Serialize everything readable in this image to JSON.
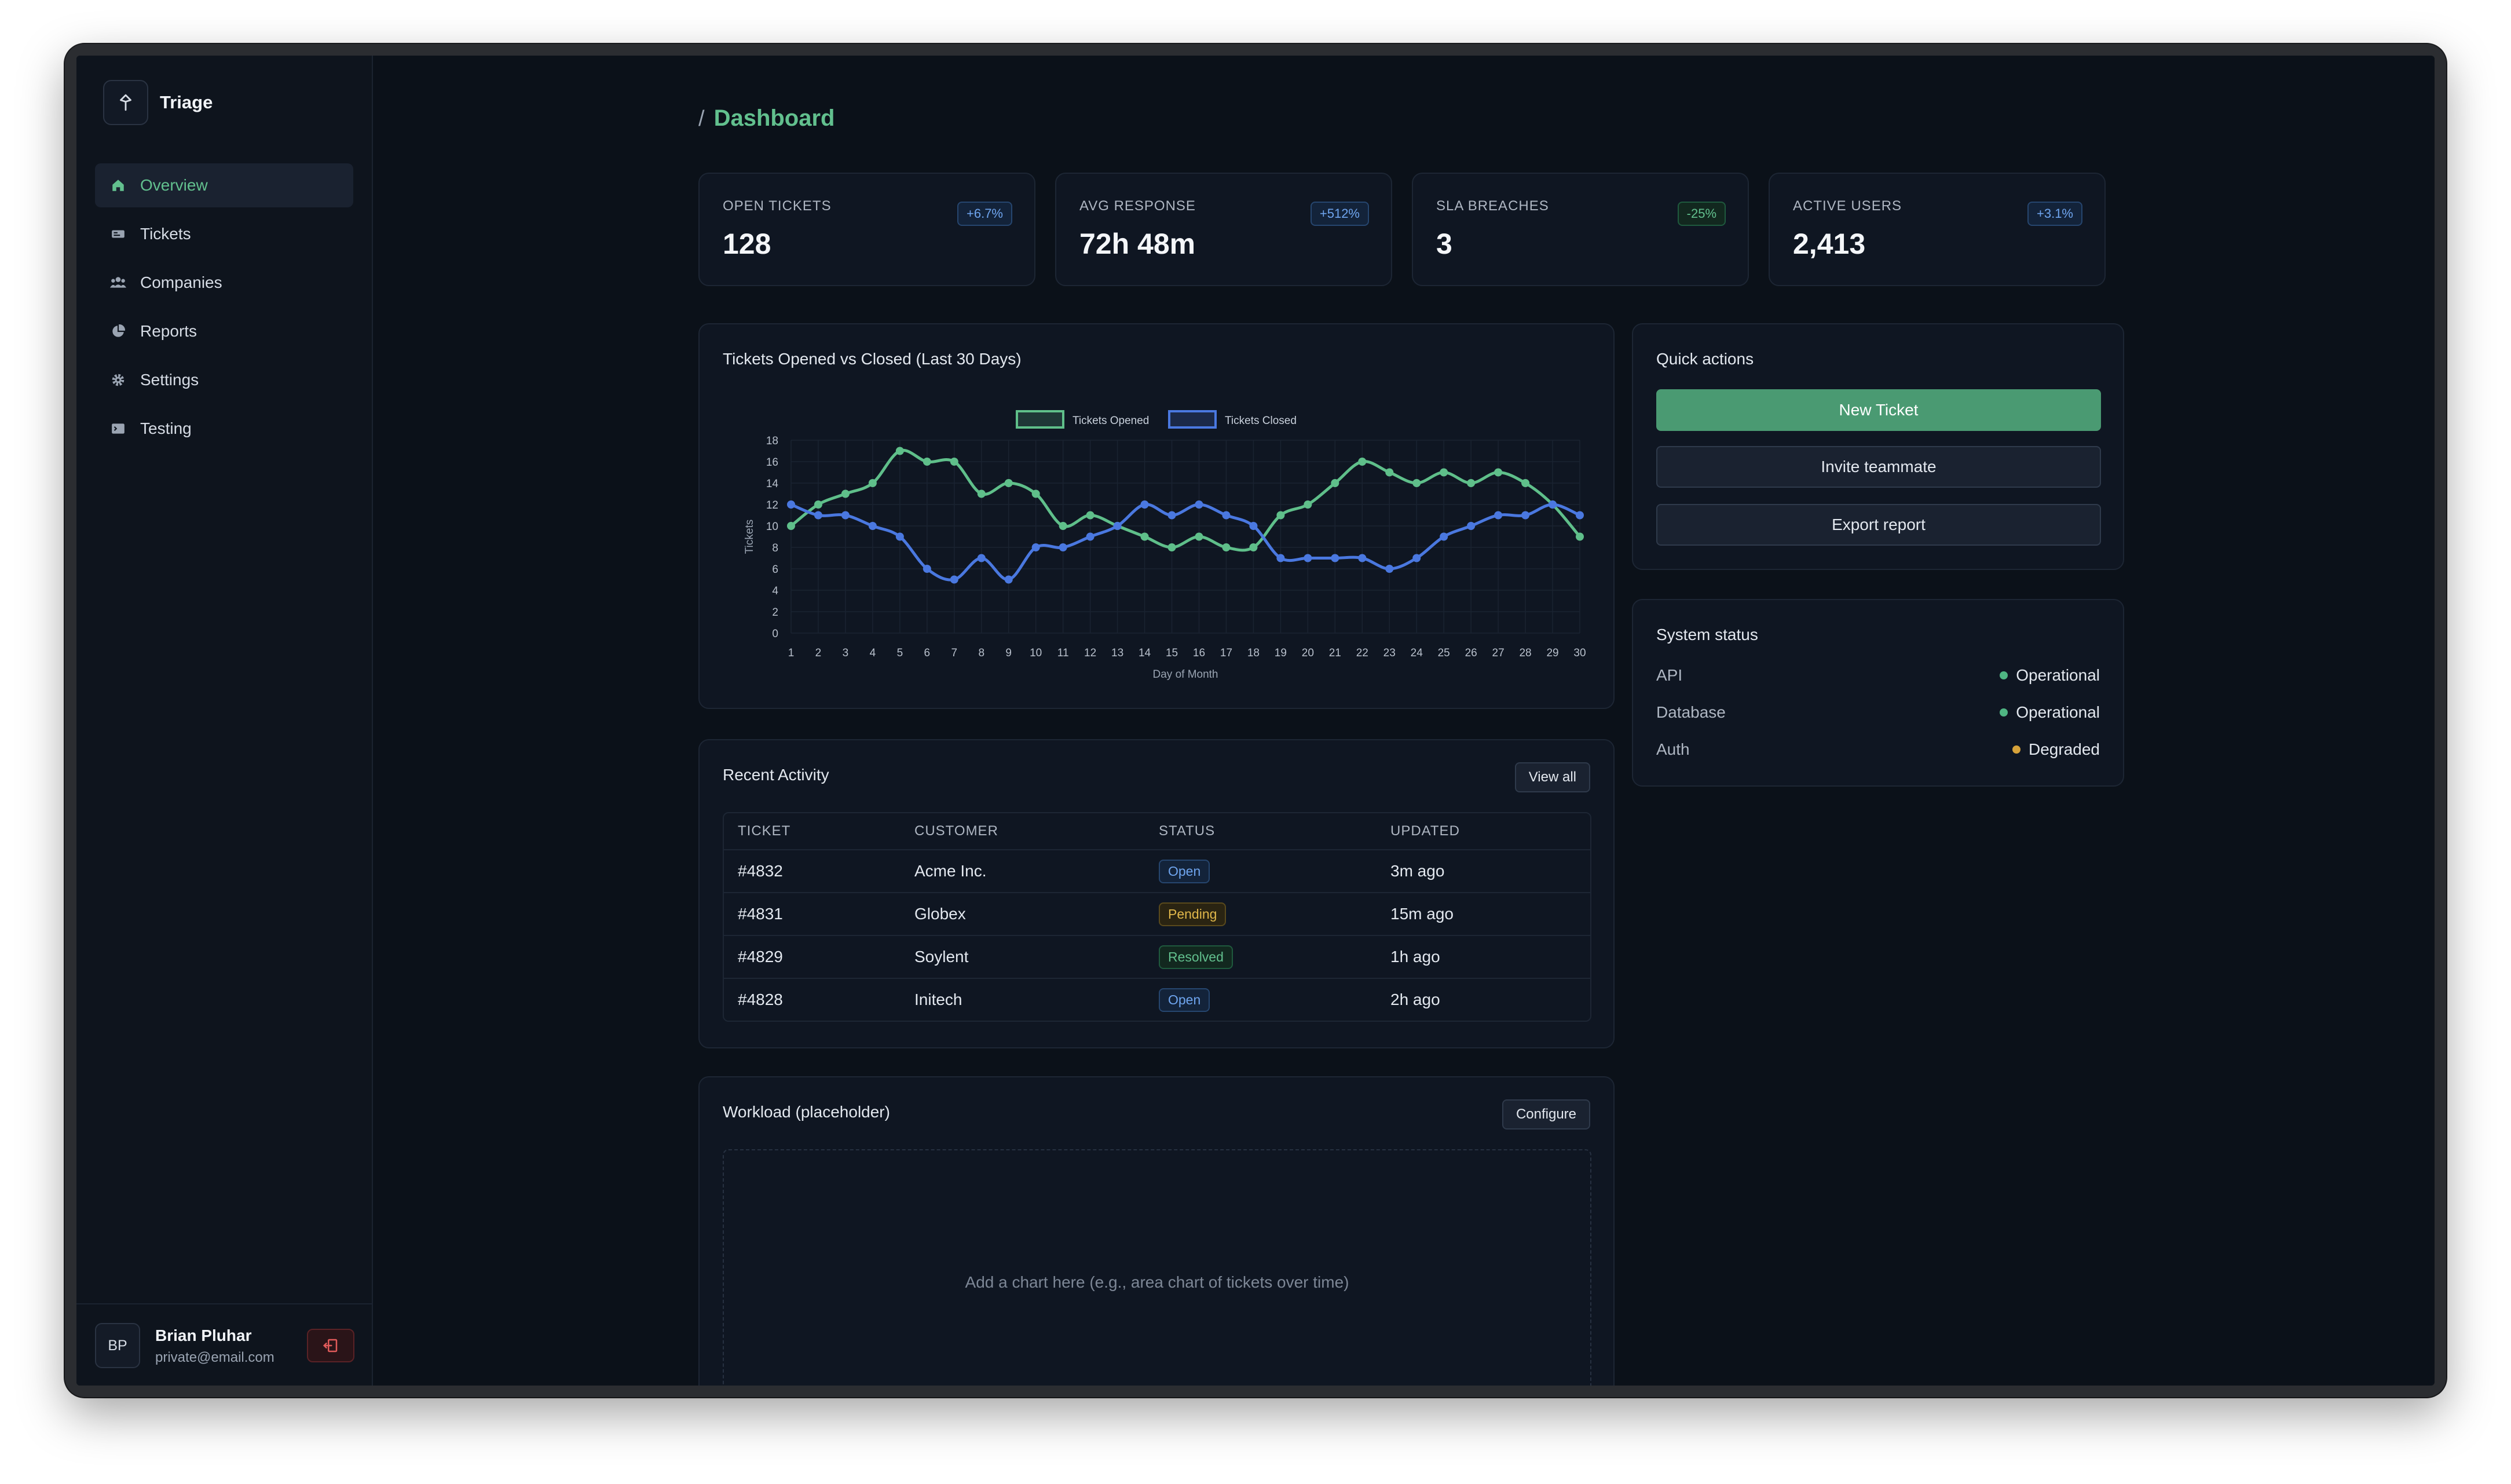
{
  "app": {
    "name": "Triage"
  },
  "sidebar": {
    "items": [
      {
        "label": "Overview",
        "icon": "home-icon",
        "active": true
      },
      {
        "label": "Tickets",
        "icon": "ticket-icon"
      },
      {
        "label": "Companies",
        "icon": "users-icon"
      },
      {
        "label": "Reports",
        "icon": "pie-chart-icon"
      },
      {
        "label": "Settings",
        "icon": "gear-icon"
      },
      {
        "label": "Testing",
        "icon": "terminal-icon"
      }
    ],
    "user": {
      "initials": "BP",
      "name": "Brian Pluhar",
      "email": "private@email.com"
    }
  },
  "header": {
    "separator": "/",
    "title": "Dashboard"
  },
  "stats": [
    {
      "label": "OPEN TICKETS",
      "value": "128",
      "badge": "+6.7%",
      "tone": "blue"
    },
    {
      "label": "AVG RESPONSE",
      "value": "72h 48m",
      "badge": "+512%",
      "tone": "blue"
    },
    {
      "label": "SLA BREACHES",
      "value": "3",
      "badge": "-25%",
      "tone": "green"
    },
    {
      "label": "ACTIVE USERS",
      "value": "2,413",
      "badge": "+3.1%",
      "tone": "blue"
    }
  ],
  "chart_card": {
    "title": "Tickets Opened vs Closed (Last 30 Days)"
  },
  "chart_data": {
    "type": "line",
    "x": [
      1,
      2,
      3,
      4,
      5,
      6,
      7,
      8,
      9,
      10,
      11,
      12,
      13,
      14,
      15,
      16,
      17,
      18,
      19,
      20,
      21,
      22,
      23,
      24,
      25,
      26,
      27,
      28,
      29,
      30
    ],
    "series": [
      {
        "name": "Tickets Opened",
        "color": "#5fbf8a",
        "values": [
          10,
          12,
          13,
          14,
          17,
          16,
          16,
          13,
          14,
          13,
          10,
          11,
          10,
          9,
          8,
          9,
          8,
          8,
          11,
          12,
          14,
          16,
          15,
          14,
          15,
          14,
          15,
          14,
          12,
          9
        ]
      },
      {
        "name": "Tickets Closed",
        "color": "#4a78e0",
        "values": [
          12,
          11,
          11,
          10,
          9,
          6,
          5,
          7,
          5,
          8,
          8,
          9,
          10,
          12,
          11,
          12,
          11,
          10,
          7,
          7,
          7,
          7,
          6,
          7,
          9,
          10,
          11,
          11,
          12,
          11
        ]
      }
    ],
    "xlabel": "Day of Month",
    "ylabel": "Tickets",
    "ylim": [
      0,
      18
    ],
    "yticks": [
      0,
      2,
      4,
      6,
      8,
      10,
      12,
      14,
      16,
      18
    ],
    "legend": "top-center",
    "grid": true
  },
  "quick_actions": {
    "title": "Quick actions",
    "primary": "New Ticket",
    "secondary": [
      "Invite teammate",
      "Export report"
    ]
  },
  "system_status": {
    "title": "System status",
    "rows": [
      {
        "name": "API",
        "state": "Operational",
        "color": "#4fb583"
      },
      {
        "name": "Database",
        "state": "Operational",
        "color": "#4fb583"
      },
      {
        "name": "Auth",
        "state": "Degraded",
        "color": "#d6a23a"
      }
    ]
  },
  "recent_activity": {
    "title": "Recent Activity",
    "view_all": "View all",
    "columns": [
      "TICKET",
      "CUSTOMER",
      "STATUS",
      "UPDATED"
    ],
    "rows": [
      {
        "ticket": "#4832",
        "customer": "Acme Inc.",
        "status": "Open",
        "updated": "3m ago"
      },
      {
        "ticket": "#4831",
        "customer": "Globex",
        "status": "Pending",
        "updated": "15m ago"
      },
      {
        "ticket": "#4829",
        "customer": "Soylent",
        "status": "Resolved",
        "updated": "1h ago"
      },
      {
        "ticket": "#4828",
        "customer": "Initech",
        "status": "Open",
        "updated": "2h ago"
      }
    ]
  },
  "workload": {
    "title": "Workload (placeholder)",
    "configure": "Configure",
    "placeholder": "Add a chart here (e.g., area chart of tickets over time)"
  }
}
